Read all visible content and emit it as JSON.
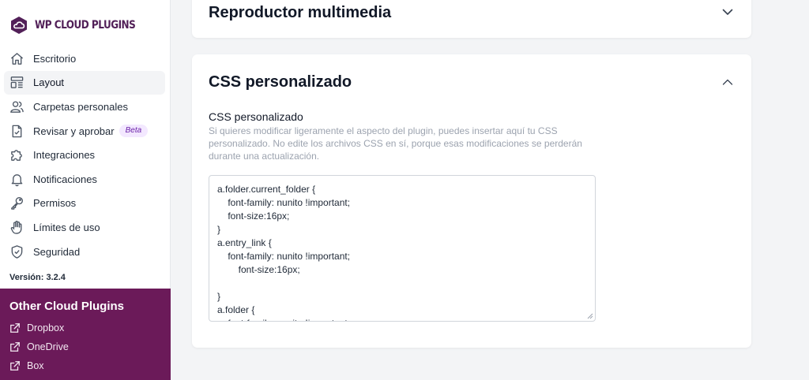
{
  "brand": {
    "name": "WP CLOUD PLUGINS",
    "color": "#522058"
  },
  "sidebar": {
    "items": [
      {
        "label": "Escritorio",
        "icon": "home-icon",
        "active": false
      },
      {
        "label": "Layout",
        "icon": "layout-icon",
        "active": true
      },
      {
        "label": "Carpetas personales",
        "icon": "users-icon",
        "active": false
      },
      {
        "label": "Revisar y aprobar",
        "icon": "document-check-icon",
        "active": false,
        "badge": "Beta"
      },
      {
        "label": "Integraciones",
        "icon": "puzzle-icon",
        "active": false
      },
      {
        "label": "Notificaciones",
        "icon": "bell-icon",
        "active": false
      },
      {
        "label": "Permisos",
        "icon": "key-icon",
        "active": false
      },
      {
        "label": "Límites de uso",
        "icon": "hand-icon",
        "active": false
      },
      {
        "label": "Seguridad",
        "icon": "shield-check-icon",
        "active": false
      }
    ],
    "version": "Versión: 3.2.4"
  },
  "other_plugins": {
    "title": "Other Cloud Plugins",
    "accent": "#6b1a59",
    "links": [
      {
        "label": "Dropbox",
        "icon": "external-link-icon"
      },
      {
        "label": "OneDrive",
        "icon": "external-link-icon"
      },
      {
        "label": "Box",
        "icon": "external-link-icon"
      }
    ]
  },
  "panels": {
    "media_player": {
      "title": "Reproductor multimedia",
      "icon": "chevron-down-icon"
    },
    "custom_css": {
      "title": "CSS personalizado",
      "icon": "chevron-up-icon",
      "field_label": "CSS personalizado",
      "help": "Si quieres modificar ligeramente el aspecto del plugin, puedes insertar aquí tu CSS personalizado. No edite los archivos CSS en sí, porque esas modificaciones se perderán durante una actualización.",
      "value": "a.folder.current_folder {\n    font-family: nunito !important;\n    font-size:16px;\n}\na.entry_link {\n    font-family: nunito !important;\n        font-size:16px;\n\n}\na.folder {\n    font-family: nunito !important;"
    }
  }
}
